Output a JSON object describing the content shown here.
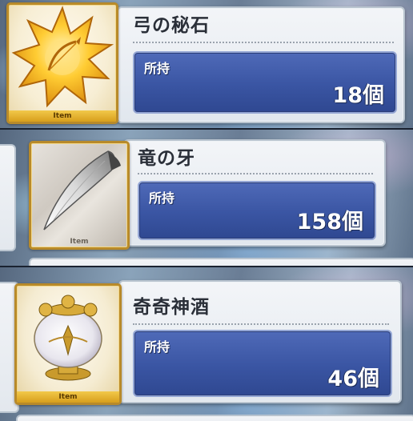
{
  "items": [
    {
      "name": "弓の秘石",
      "count_label": "所持",
      "count_value": "18個",
      "frame_tag": "Item",
      "icon": "golden-star-bow-gem-icon"
    },
    {
      "name": "竜の牙",
      "count_label": "所持",
      "count_value": "158個",
      "frame_tag": "Item",
      "icon": "dragon-fang-icon"
    },
    {
      "name": "奇奇神酒",
      "count_label": "所持",
      "count_value": "46個",
      "frame_tag": "Item",
      "icon": "ornate-jar-icon"
    }
  ],
  "colors": {
    "count_box": "#3a55a3",
    "gold_frame": "#b88a2a",
    "card_bg": "#e9edf2"
  }
}
